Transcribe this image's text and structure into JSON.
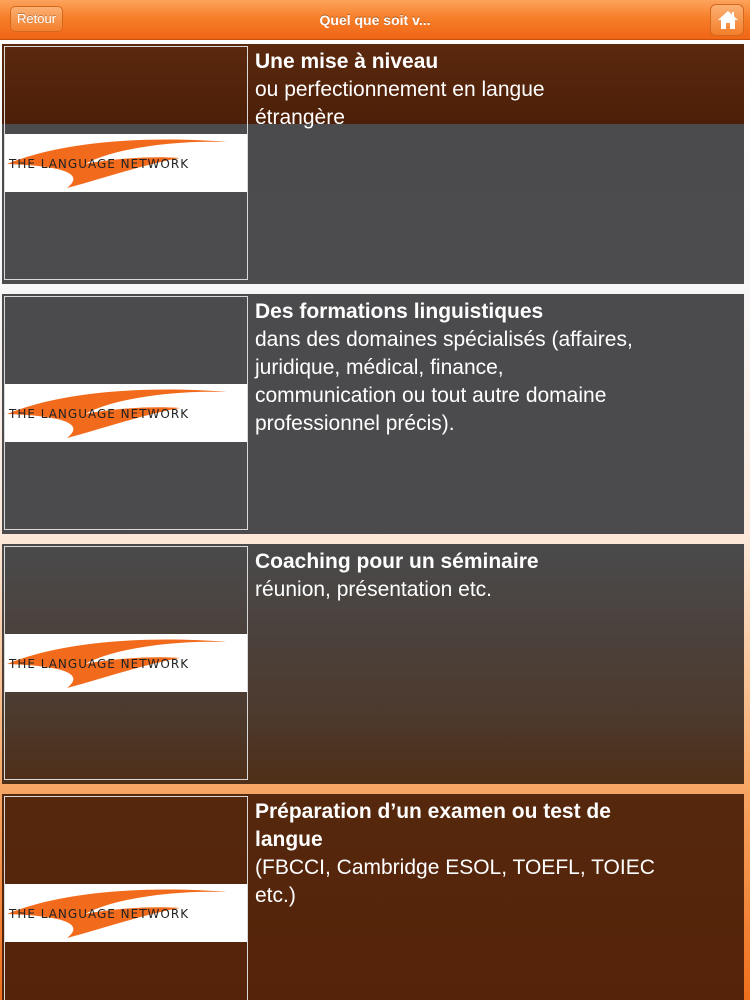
{
  "header": {
    "back_label": "Retour",
    "title": "Quel que soit v...",
    "home_icon": "home-icon"
  },
  "logo": {
    "brand": "The Language Network",
    "swoosh_color": "#f26b1d"
  },
  "items": [
    {
      "title": "Une mise à niveau",
      "subtitle": "ou perfectionnement en langue étrangère"
    },
    {
      "title": "Des formations linguistiques",
      "subtitle": "dans des domaines spécialisés (affaires, juridique, médical, finance, communication ou tout autre domaine professionnel précis)."
    },
    {
      "title": "Coaching pour un séminaire",
      "subtitle": "réunion, présentation etc."
    },
    {
      "title": "Préparation d’un examen ou test de langue",
      "subtitle": "(FBCCI, Cambridge ESOL, TOEFL, TOIEC etc.)"
    }
  ],
  "colors": {
    "accent": "#f77f2a",
    "card_brown": "#4d1f08",
    "card_grey": "#4b4b4d"
  }
}
